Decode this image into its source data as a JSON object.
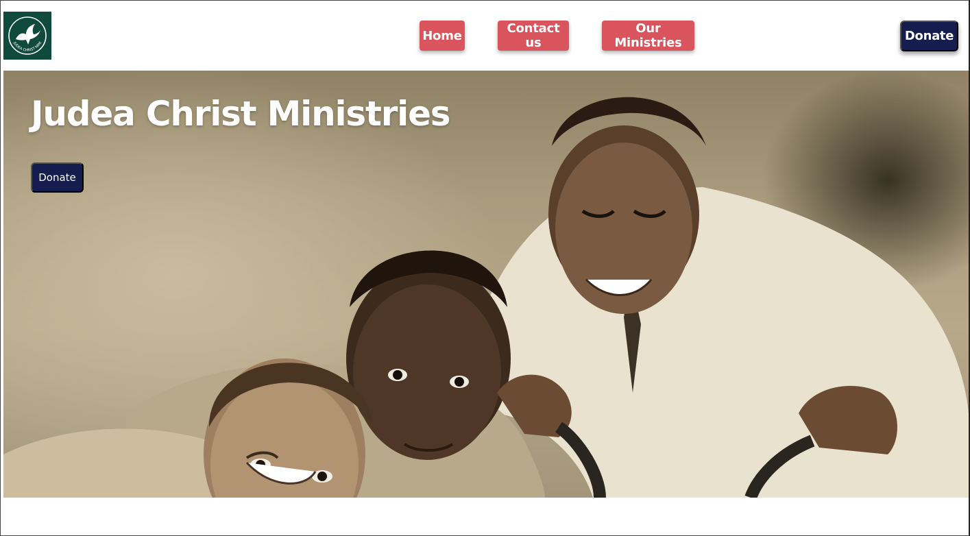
{
  "header": {
    "logo": {
      "icon": "dove-icon",
      "text": "JUDEA CHRIST MINISTRIES"
    },
    "nav": [
      {
        "label": "Home"
      },
      {
        "label": "Contact us"
      },
      {
        "label": "Our Ministries"
      }
    ],
    "donate_label": "Donate"
  },
  "hero": {
    "title": "Judea Christ Ministries",
    "donate_label": "Donate",
    "image": "three smiling boys photo"
  },
  "colors": {
    "nav_button": "#d9545c",
    "donate_button": "#151d4f",
    "logo_bg": "#0f4a3c"
  }
}
